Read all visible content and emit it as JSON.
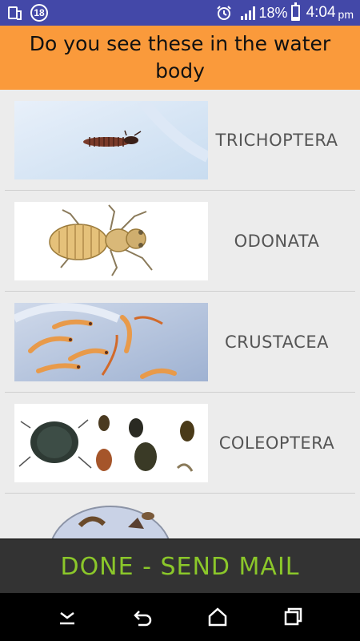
{
  "status_bar": {
    "notification_badge": "18",
    "battery_percent": "18%",
    "time": "4:04",
    "ampm": "pm",
    "icons": [
      "phone-icon",
      "badge-icon",
      "alarm-icon",
      "signal-icon",
      "battery-icon"
    ]
  },
  "header": {
    "title": "Do you see these in the water body"
  },
  "list": {
    "items": [
      {
        "label": "TRICHOPTERA",
        "image": "caddisfly-larva-image"
      },
      {
        "label": "ODONATA",
        "image": "dragonfly-nymph-image"
      },
      {
        "label": "CRUSTACEA",
        "image": "shrimp-image"
      },
      {
        "label": "COLEOPTERA",
        "image": "water-beetles-image"
      },
      {
        "label": "",
        "image": "bowl-specimen-image"
      }
    ]
  },
  "done_button": {
    "label": "DONE - SEND MAIL",
    "color": "#8bc72a"
  },
  "nav_bar": {
    "icons": [
      "keyboard-down-icon",
      "back-icon",
      "home-icon",
      "recents-icon"
    ]
  },
  "colors": {
    "status_bar": "#4348a8",
    "header": "#fa9a3b",
    "list_background": "#ececec",
    "done_bar": "#333333"
  }
}
